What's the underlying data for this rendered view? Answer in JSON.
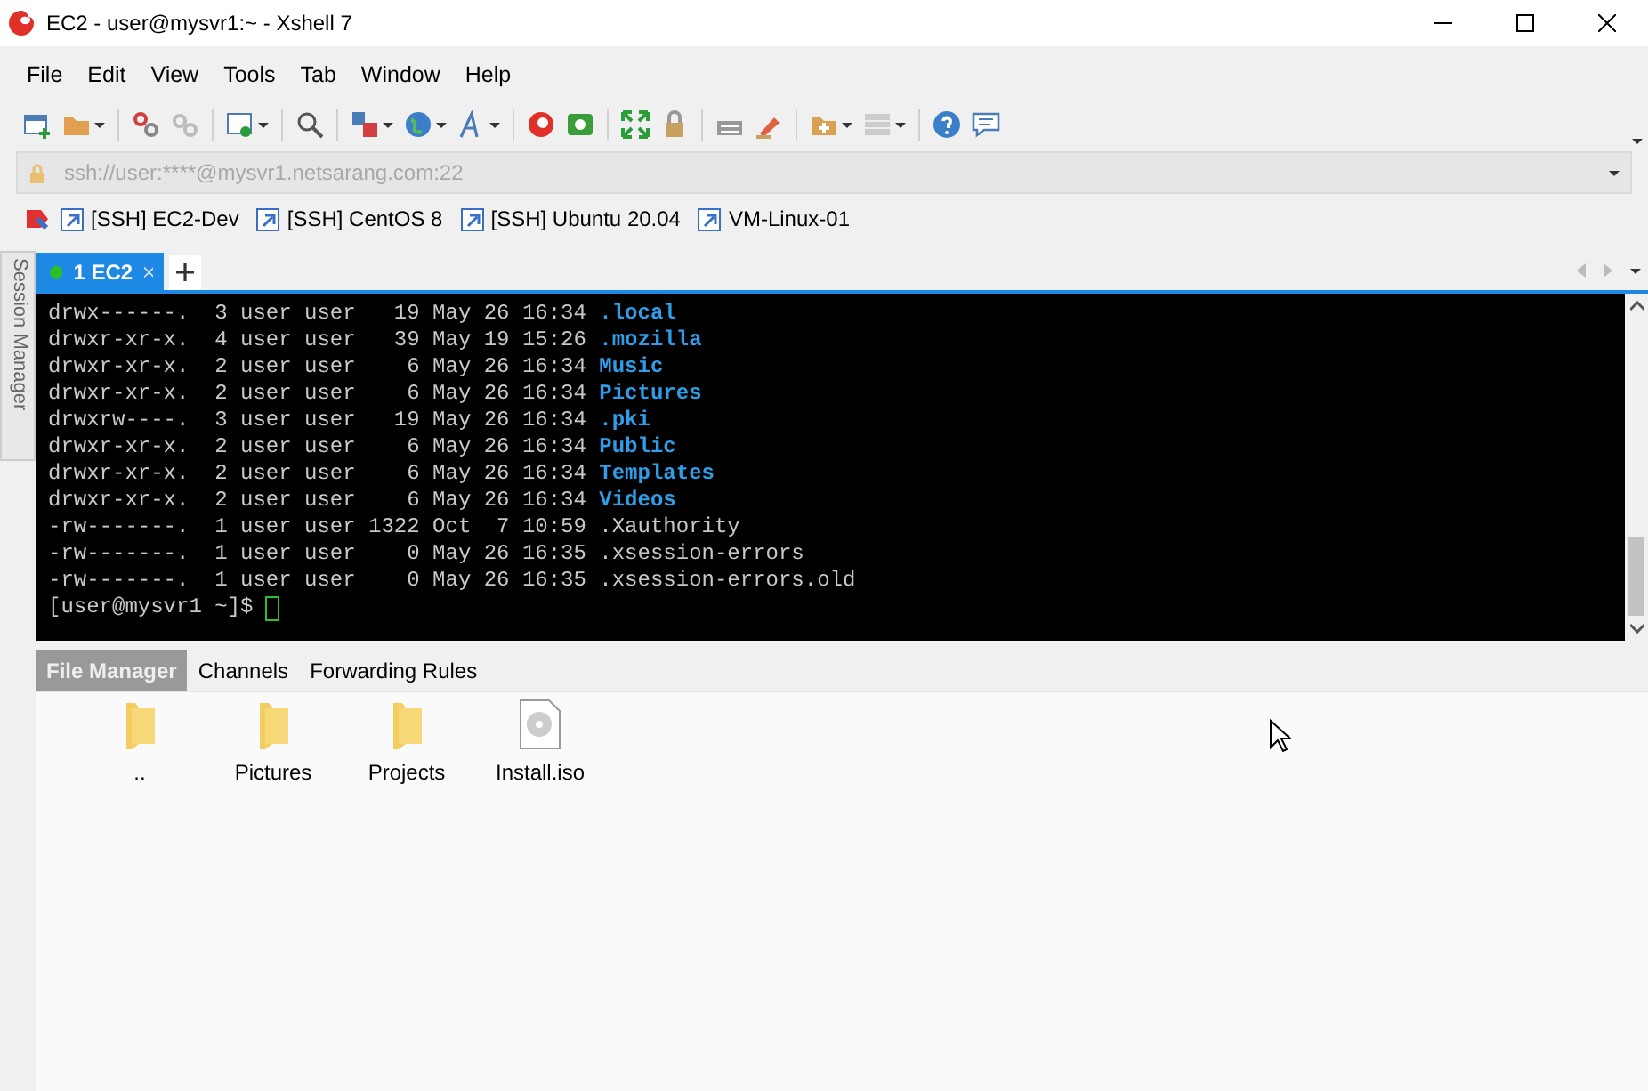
{
  "window": {
    "title": "EC2 - user@mysvr1:~ - Xshell 7"
  },
  "menu": [
    "File",
    "Edit",
    "View",
    "Tools",
    "Tab",
    "Window",
    "Help"
  ],
  "address": {
    "value": "ssh://user:****@mysvr1.netsarang.com:22"
  },
  "links": [
    "[SSH] EC2-Dev",
    "[SSH] CentOS 8",
    "[SSH] Ubuntu 20.04",
    "VM-Linux-01"
  ],
  "session_manager": {
    "label": "Session Manager"
  },
  "tabs": [
    {
      "label": "1 EC2",
      "selected": true,
      "connected": true
    }
  ],
  "terminal": {
    "lines": [
      {
        "text": "drwx------.  3 user user   19 May 26 16:34 ",
        "name": ".local",
        "kind": "dir"
      },
      {
        "text": "drwxr-xr-x.  4 user user   39 May 19 15:26 ",
        "name": ".mozilla",
        "kind": "dir"
      },
      {
        "text": "drwxr-xr-x.  2 user user    6 May 26 16:34 ",
        "name": "Music",
        "kind": "dir"
      },
      {
        "text": "drwxr-xr-x.  2 user user    6 May 26 16:34 ",
        "name": "Pictures",
        "kind": "dir"
      },
      {
        "text": "drwxrw----.  3 user user   19 May 26 16:34 ",
        "name": ".pki",
        "kind": "dir"
      },
      {
        "text": "drwxr-xr-x.  2 user user    6 May 26 16:34 ",
        "name": "Public",
        "kind": "dir"
      },
      {
        "text": "drwxr-xr-x.  2 user user    6 May 26 16:34 ",
        "name": "Templates",
        "kind": "dir"
      },
      {
        "text": "drwxr-xr-x.  2 user user    6 May 26 16:34 ",
        "name": "Videos",
        "kind": "dir"
      },
      {
        "text": "-rw-------.  1 user user 1322 Oct  7 10:59 ",
        "name": ".Xauthority",
        "kind": "file"
      },
      {
        "text": "-rw-------.  1 user user    0 May 26 16:35 ",
        "name": ".xsession-errors",
        "kind": "file"
      },
      {
        "text": "-rw-------.  1 user user    0 May 26 16:35 ",
        "name": ".xsession-errors.old",
        "kind": "file"
      }
    ],
    "prompt": "[user@mysvr1 ~]$ "
  },
  "bottom_tabs": [
    {
      "label": "File Manager",
      "selected": true
    },
    {
      "label": "Channels",
      "selected": false
    },
    {
      "label": "Forwarding Rules",
      "selected": false
    }
  ],
  "files": [
    {
      "name": "..",
      "kind": "folder"
    },
    {
      "name": "Pictures",
      "kind": "folder"
    },
    {
      "name": "Projects",
      "kind": "folder"
    },
    {
      "name": "Install.iso",
      "kind": "disc"
    }
  ]
}
